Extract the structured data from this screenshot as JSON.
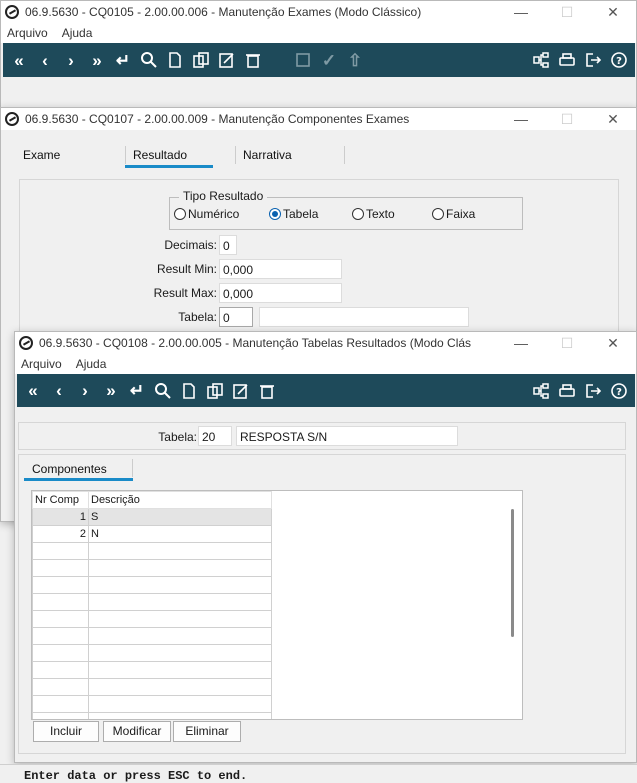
{
  "window1": {
    "title": "06.9.5630 - CQ0105 - 2.00.00.006 - Manutenção Exames (Modo Clássico)",
    "menu": [
      "Arquivo",
      "Ajuda"
    ]
  },
  "window2": {
    "title": "06.9.5630 - CQ0107 - 2.00.00.009 - Manutenção Componentes Exames",
    "tabs": [
      "Exame",
      "Resultado",
      "Narrativa"
    ],
    "tipo_resultado": {
      "legend": "Tipo Resultado",
      "options": [
        "Numérico",
        "Tabela",
        "Texto",
        "Faixa"
      ],
      "selected": "Tabela"
    },
    "decimais": {
      "label": "Decimais:",
      "value": "0"
    },
    "result_min": {
      "label": "Result Min:",
      "value": "0,000"
    },
    "result_max": {
      "label": "Result Max:",
      "value": "0,000"
    },
    "tabela": {
      "label": "Tabela:",
      "value": "0"
    }
  },
  "window3": {
    "title": "06.9.5630 - CQ0108 - 2.00.00.005 - Manutenção Tabelas Resultados (Modo Clás",
    "menu": [
      "Arquivo",
      "Ajuda"
    ],
    "tabela": {
      "label": "Tabela:",
      "code": "20",
      "description": "RESPOSTA S/N"
    },
    "tab": "Componentes",
    "grid": {
      "headers": [
        "Nr Comp",
        "Descrição"
      ],
      "rows": [
        {
          "nr": "1",
          "desc": "S"
        },
        {
          "nr": "2",
          "desc": "N"
        }
      ]
    },
    "buttons": {
      "incluir": "Incluir",
      "modificar": "Modificar",
      "eliminar": "Eliminar"
    }
  },
  "status": "Enter data or press ESC to end.",
  "icons": {
    "toolbar_left": [
      "first-icon",
      "prev-icon",
      "next-icon",
      "last-icon",
      "goto-icon",
      "search-icon",
      "new-icon",
      "copy-icon",
      "edit-icon",
      "delete-icon"
    ],
    "toolbar_right": [
      "tree-icon",
      "print-icon",
      "exit-icon",
      "help-icon"
    ]
  },
  "colors": {
    "toolbar": "#1e4a5a",
    "accent": "#1a8bc8"
  }
}
